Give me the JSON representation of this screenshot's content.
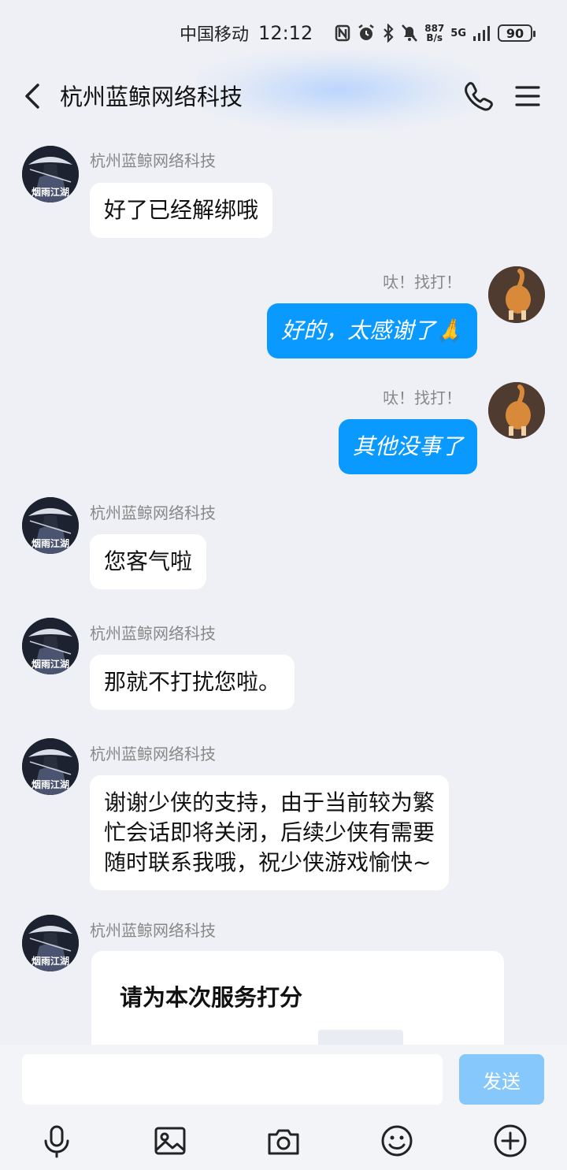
{
  "status_bar": {
    "carrier": "中国移动",
    "time": "12:12",
    "net_speed_value": "887",
    "net_speed_unit": "B/s",
    "network": "5G",
    "battery": "90"
  },
  "header": {
    "title": "杭州蓝鲸网络科技"
  },
  "messages": [
    {
      "sender": "杭州蓝鲸网络科技",
      "text": "好了已经解绑哦"
    },
    {
      "sender": "呔！找打！",
      "text": "好的，太感谢了🙏"
    },
    {
      "sender": "呔！找打！",
      "text": "其他没事了"
    },
    {
      "sender": "杭州蓝鲸网络科技",
      "text": "您客气啦"
    },
    {
      "sender": "杭州蓝鲸网络科技",
      "text": "那就不打扰您啦。"
    },
    {
      "sender": "杭州蓝鲸网络科技",
      "text_lines": [
        "谢谢少侠的支持，由于当前较为繁",
        "忙会话即将关闭，后续少侠有需要",
        "随时联系我哦，祝少侠游戏愉快~"
      ]
    },
    {
      "sender": "杭州蓝鲸网络科技",
      "card_title": "请为本次服务打分"
    }
  ],
  "avatar_text": "烟雨江湖",
  "input_bar": {
    "send_label": "发送",
    "input_value": ""
  },
  "toolbar_icons": [
    "microphone-icon",
    "image-icon",
    "camera-icon",
    "emoji-icon",
    "plus-icon"
  ],
  "colors": {
    "accent": "#0a99ff",
    "send_disabled": "#86c8fb",
    "background": "#eef0f5"
  }
}
